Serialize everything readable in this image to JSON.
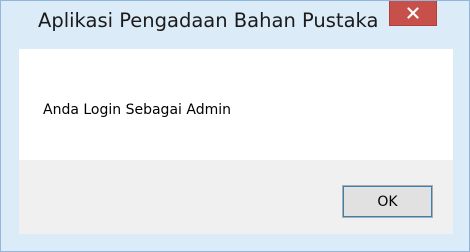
{
  "dialog": {
    "title": "Aplikasi Pengadaan Bahan Pustaka",
    "message": "Anda Login Sebagai Admin",
    "ok_label": "OK",
    "close_icon": "close-icon",
    "colors": {
      "frame": "#dcebf8",
      "close_button": "#c7504b",
      "content_bg": "#ffffff",
      "footer_bg": "#f0f0f0"
    }
  }
}
